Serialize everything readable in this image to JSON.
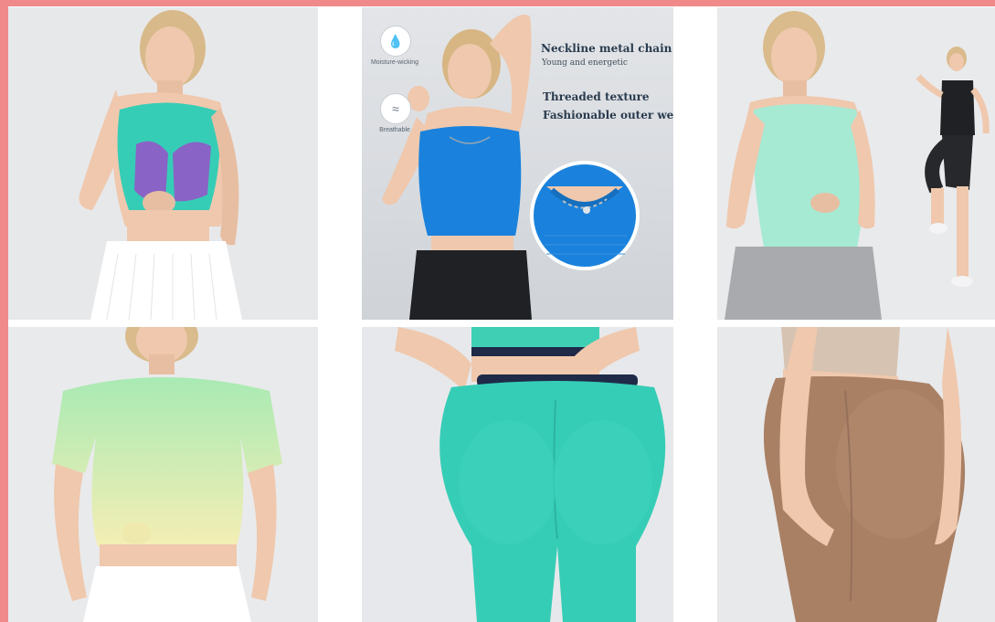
{
  "tiles": [
    {
      "id": "t1",
      "name": "product-tile-mesh-sports-bra"
    },
    {
      "id": "t2",
      "name": "product-tile-blue-crop-top"
    },
    {
      "id": "t3",
      "name": "product-tile-mint-tank-top"
    },
    {
      "id": "t4",
      "name": "product-tile-gradient-tee"
    },
    {
      "id": "t5",
      "name": "product-tile-teal-leggings"
    },
    {
      "id": "t6",
      "name": "product-tile-mocha-leggings"
    }
  ],
  "features": {
    "moisture_label": "Moisture-wicking",
    "breathable_label": "Breathable",
    "moisture_icon": "droplet-icon",
    "breathable_icon": "fabric-icon"
  },
  "callouts": {
    "chain_title": "Neckline metal chain",
    "chain_sub": "Young and energetic",
    "texture_title": "Threaded texture",
    "texture_sub": "Fashionable outer wear"
  },
  "colors": {
    "frame": "#f08a8a",
    "tile_bg": "#e9eaec",
    "skin": "#efc8ad",
    "teal": "#36cdb6",
    "blue": "#1a82dc",
    "mint": "#a6ead4",
    "mocha": "#a98064"
  }
}
